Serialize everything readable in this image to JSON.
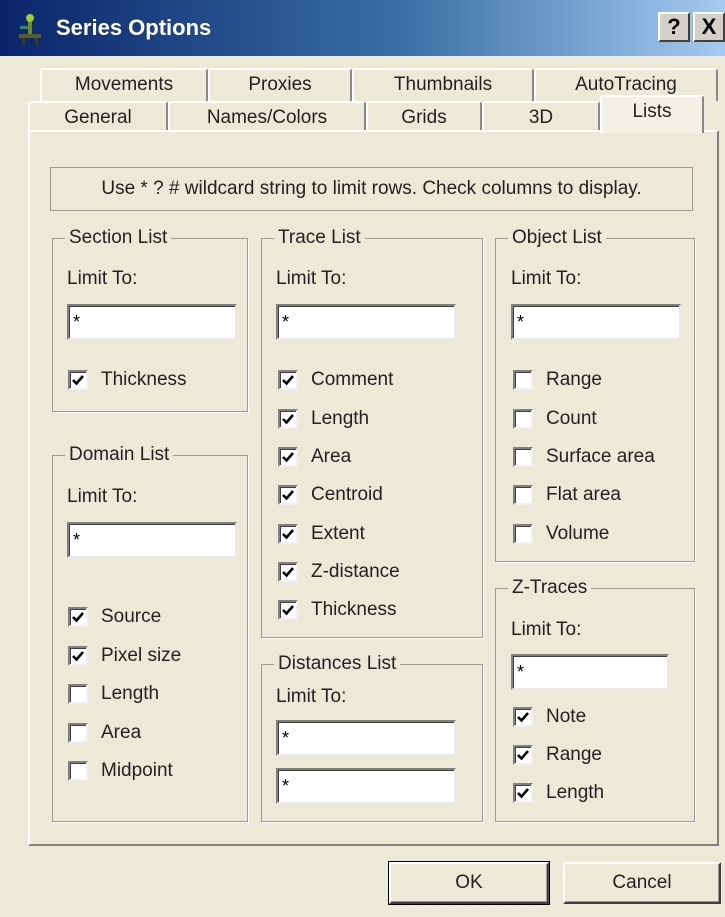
{
  "window": {
    "title": "Series Options",
    "help_label": "?",
    "close_label": "X"
  },
  "tabs": {
    "row1": [
      "Movements",
      "Proxies",
      "Thumbnails",
      "AutoTracing"
    ],
    "row2": [
      "General",
      "Names/Colors",
      "Grids",
      "3D",
      "Lists"
    ],
    "active": "Lists"
  },
  "info_text": "Use * ? # wildcard string to limit rows. Check columns to display.",
  "section_list": {
    "title": "Section List",
    "limit_label": "Limit To:",
    "limit_value": "*",
    "columns": [
      {
        "label": "Thickness",
        "checked": true
      }
    ]
  },
  "domain_list": {
    "title": "Domain List",
    "limit_label": "Limit To:",
    "limit_value": "*",
    "columns": [
      {
        "label": "Source",
        "checked": true
      },
      {
        "label": "Pixel size",
        "checked": true
      },
      {
        "label": "Length",
        "checked": false
      },
      {
        "label": "Area",
        "checked": false
      },
      {
        "label": "Midpoint",
        "checked": false
      }
    ]
  },
  "trace_list": {
    "title": "Trace List",
    "limit_label": "Limit To:",
    "limit_value": "*",
    "columns": [
      {
        "label": "Comment",
        "checked": true
      },
      {
        "label": "Length",
        "checked": true
      },
      {
        "label": "Area",
        "checked": true
      },
      {
        "label": "Centroid",
        "checked": true
      },
      {
        "label": "Extent",
        "checked": true
      },
      {
        "label": "Z-distance",
        "checked": true
      },
      {
        "label": "Thickness",
        "checked": true
      }
    ]
  },
  "distances_list": {
    "title": "Distances List",
    "limit_label": "Limit To:",
    "limit_value_1": "*",
    "limit_value_2": "*"
  },
  "object_list": {
    "title": "Object List",
    "limit_label": "Limit To:",
    "limit_value": "*",
    "columns": [
      {
        "label": "Range",
        "checked": false
      },
      {
        "label": "Count",
        "checked": false
      },
      {
        "label": "Surface area",
        "checked": false
      },
      {
        "label": "Flat area",
        "checked": false
      },
      {
        "label": "Volume",
        "checked": false
      }
    ]
  },
  "z_traces": {
    "title": "Z-Traces",
    "limit_label": "Limit To:",
    "limit_value": "*",
    "columns": [
      {
        "label": "Note",
        "checked": true
      },
      {
        "label": "Range",
        "checked": true
      },
      {
        "label": "Length",
        "checked": true
      }
    ]
  },
  "buttons": {
    "ok": "OK",
    "cancel": "Cancel"
  }
}
